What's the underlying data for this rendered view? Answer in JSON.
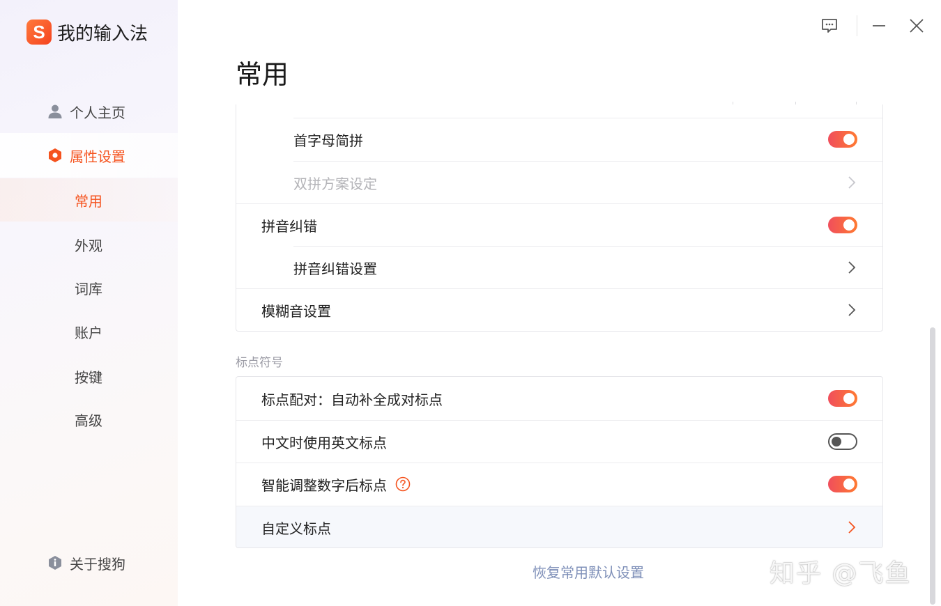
{
  "app": {
    "title": "我的输入法",
    "logo_letter": "S"
  },
  "sidebar": {
    "nav": [
      {
        "label": "个人主页",
        "icon": "user-icon",
        "active": false
      },
      {
        "label": "属性设置",
        "icon": "hexagon-settings-icon",
        "active": true
      }
    ],
    "sub_items": [
      {
        "label": "常用",
        "active": true
      },
      {
        "label": "外观",
        "active": false
      },
      {
        "label": "词库",
        "active": false
      },
      {
        "label": "账户",
        "active": false
      },
      {
        "label": "按键",
        "active": false
      },
      {
        "label": "高级",
        "active": false
      }
    ],
    "about": {
      "label": "关于搜狗",
      "icon": "info-shield-icon"
    }
  },
  "window_controls": [
    "feedback-icon",
    "minimize-icon",
    "close-icon"
  ],
  "page": {
    "title": "常用"
  },
  "pinyin_card": {
    "rows": [
      {
        "label": "首字母简拼",
        "control": "toggle",
        "on": true,
        "indent": true,
        "disabled": false
      },
      {
        "label": "双拼方案设定",
        "control": "chevron",
        "indent": true,
        "disabled": true
      },
      {
        "label": "拼音纠错",
        "control": "toggle",
        "on": true,
        "indent": false,
        "disabled": false
      },
      {
        "label": "拼音纠错设置",
        "control": "chevron",
        "indent": true,
        "disabled": false
      },
      {
        "label": "模糊音设置",
        "control": "chevron",
        "indent": false,
        "disabled": false
      }
    ]
  },
  "punctuation": {
    "section_label": "标点符号",
    "rows": [
      {
        "label": "标点配对：自动补全成对标点",
        "control": "toggle",
        "on": true
      },
      {
        "label": "中文时使用英文标点",
        "control": "toggle",
        "on": false
      },
      {
        "label": "智能调整数字后标点",
        "control": "toggle",
        "on": true,
        "help": true
      },
      {
        "label": "自定义标点",
        "control": "chevron",
        "hover": true
      }
    ]
  },
  "footer": {
    "reset_label": "恢复常用默认设置"
  },
  "watermark": {
    "text": "知乎 @飞鱼"
  },
  "colors": {
    "accent": "#f5531e",
    "toggle_on_start": "#f04e5c",
    "toggle_on_end": "#ff7a32",
    "link": "#7e8fb8"
  }
}
